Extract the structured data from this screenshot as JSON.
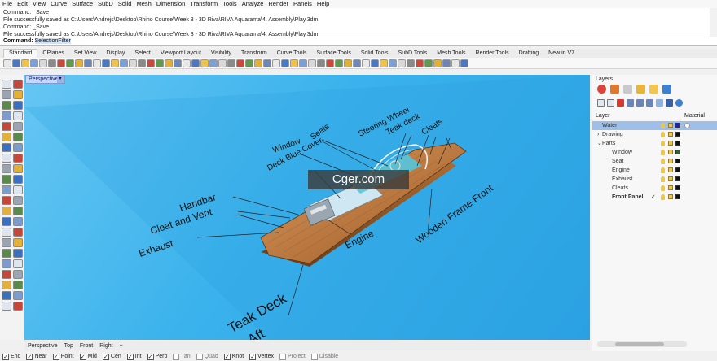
{
  "menu": [
    "File",
    "Edit",
    "View",
    "Curve",
    "Surface",
    "SubD",
    "Solid",
    "Mesh",
    "Dimension",
    "Transform",
    "Tools",
    "Analyze",
    "Render",
    "Panels",
    "Help"
  ],
  "command_history": [
    "Command: _Save",
    "File successfully saved as C:\\Users\\Andrejs\\Desktop\\Rhino Course\\Week 3 - 3D Riva\\RIVA Aquarama\\4. Assembly\\Play.3dm.",
    "Command: _Save",
    "File successfully saved as C:\\Users\\Andrejs\\Desktop\\Rhino Course\\Week 3 - 3D Riva\\RIVA Aquarama\\4. Assembly\\Play.3dm."
  ],
  "command_line": {
    "label": "Command:",
    "value": "SelectionFilter"
  },
  "toolbar_tabs": [
    "Standard",
    "CPlanes",
    "Set View",
    "Display",
    "Select",
    "Viewport Layout",
    "Visibility",
    "Transform",
    "Curve Tools",
    "Surface Tools",
    "Solid Tools",
    "SubD Tools",
    "Mesh Tools",
    "Render Tools",
    "Drafting",
    "New in V7"
  ],
  "active_tab": "Standard",
  "viewport": {
    "name": "Perspective",
    "dropdown_glyph": "▾",
    "tabs": [
      "Perspective",
      "Top",
      "Front",
      "Right"
    ],
    "add_tab": "+",
    "annotations": {
      "seats": "Seats",
      "steering": "Steering Wheel",
      "teak_deck_top": "Teak deck",
      "cleats": "Cleats",
      "window": "Window",
      "deck_cover": "Deck Blue Cover",
      "handbar": "Handbar",
      "cleat_vent": "Cleat and Vent",
      "exhaust": "Exhaust",
      "engine": "Engine",
      "wooden_frame": "Wooden Frame Front",
      "teak_deck_aft": "Teak Deck",
      "aft": "Aft"
    }
  },
  "watermark": "Cger.com",
  "layers_panel": {
    "title": "Layers",
    "col_layer": "Layer",
    "col_material": "Material",
    "rows": [
      {
        "name": "Water",
        "indent": 0,
        "selected": true,
        "color": "#1a1fd0",
        "material": true
      },
      {
        "name": "Drawing",
        "indent": 0,
        "expander": "›",
        "color": "#111111"
      },
      {
        "name": "Parts",
        "indent": 0,
        "expander": "⌄",
        "color": "#111111"
      },
      {
        "name": "Window",
        "indent": 1,
        "color": "#1e6a2a"
      },
      {
        "name": "Seat",
        "indent": 1,
        "color": "#111111"
      },
      {
        "name": "Engine",
        "indent": 1,
        "color": "#111111"
      },
      {
        "name": "Exhaust",
        "indent": 1,
        "color": "#111111"
      },
      {
        "name": "Cleats",
        "indent": 1,
        "color": "#111111"
      },
      {
        "name": "Front Panel",
        "indent": 1,
        "bold": true,
        "check": "✓",
        "color": "#111111"
      }
    ]
  },
  "status_snaps": [
    {
      "label": "End",
      "on": true
    },
    {
      "label": "Near",
      "on": true
    },
    {
      "label": "Point",
      "on": true
    },
    {
      "label": "Mid",
      "on": true
    },
    {
      "label": "Cen",
      "on": true
    },
    {
      "label": "Int",
      "on": true
    },
    {
      "label": "Perp",
      "on": true
    },
    {
      "label": "Tan",
      "on": false
    },
    {
      "label": "Quad",
      "on": false
    },
    {
      "label": "Knot",
      "on": true
    },
    {
      "label": "Vertex",
      "on": true
    },
    {
      "label": "Project",
      "on": false
    },
    {
      "label": "Disable",
      "on": false
    }
  ],
  "colors": {
    "viewport_bg": "#3ab2ec",
    "hull_wood": "#b9773f",
    "selected_layer": "#9fbfe6"
  }
}
